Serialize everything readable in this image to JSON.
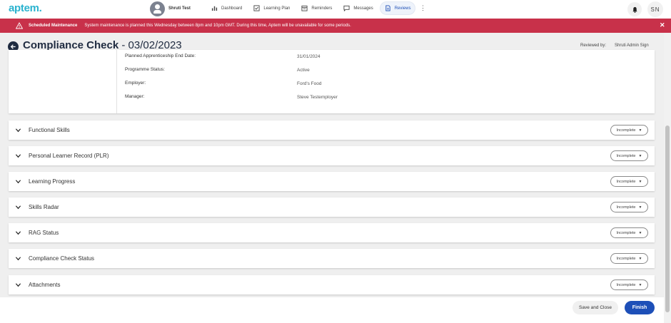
{
  "app": {
    "logo": "aptem."
  },
  "user": {
    "name": "Shruti Test",
    "initials": "SN"
  },
  "nav": {
    "items": [
      {
        "label": "Dashboard",
        "icon": "bar-chart-icon"
      },
      {
        "label": "Learning Plan",
        "icon": "checkbox-icon"
      },
      {
        "label": "Reminders",
        "icon": "calendar-icon"
      },
      {
        "label": "Messages",
        "icon": "chat-icon"
      },
      {
        "label": "Reviews",
        "icon": "document-icon",
        "active": true
      }
    ]
  },
  "banner": {
    "title": "Scheduled Maintenance",
    "message": "System maintenance is planned this Wednesday between 8pm and 10pm GMT. During this time, Aptem will be unavailable for some periods.",
    "color": "#c8314a"
  },
  "header": {
    "title": "Compliance Check",
    "date": " - 03/02/2023",
    "reviewed_by_label": "Reviewed by:",
    "reviewer": "Shruti Admin Sign"
  },
  "details": [
    {
      "label": "Planned Apprenticeship End Date:",
      "value": "31/01/2024"
    },
    {
      "label": "Programme Status:",
      "value": "Active"
    },
    {
      "label": "Employer:",
      "value": "Ford's Food"
    },
    {
      "label": "Manager:",
      "value": "Steve Testemployer"
    }
  ],
  "sections": [
    {
      "title": "Functional Skills",
      "status": "Incomplete"
    },
    {
      "title": "Personal Learner Record (PLR)",
      "status": "Incomplete"
    },
    {
      "title": "Learning Progress",
      "status": "Incomplete"
    },
    {
      "title": "Skills Radar",
      "status": "Incomplete"
    },
    {
      "title": "RAG Status",
      "status": "Incomplete"
    },
    {
      "title": "Compliance Check Status",
      "status": "Incomplete"
    },
    {
      "title": "Attachments",
      "status": "Incomplete"
    }
  ],
  "footer": {
    "save_label": "Save and Close",
    "finish_label": "Finish"
  },
  "colors": {
    "accent": "#1d4fb8",
    "logo": "#2ab3cf",
    "banner": "#c8314a"
  }
}
